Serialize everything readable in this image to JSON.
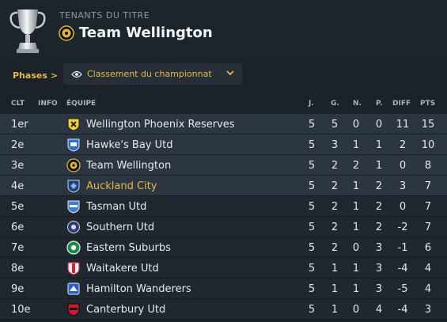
{
  "header": {
    "holder_label": "TENANTS DU TITRE",
    "holder_team": "Team Wellington"
  },
  "toolbar": {
    "phases_label": "Phases",
    "phases_chevron": ">",
    "view_label": "Classement du championnat"
  },
  "table": {
    "columns": [
      "CLT",
      "INFO",
      "ÉQUIPE",
      "J.",
      "G.",
      "N.",
      "P.",
      "DIFF",
      "PTS"
    ],
    "rows": [
      {
        "pos": "1er",
        "team": "Wellington Phoenix Reserves",
        "j": "5",
        "g": "5",
        "n": "0",
        "p": "0",
        "diff": "11",
        "pts": "15",
        "badge": "yellow-black-crest"
      },
      {
        "pos": "2e",
        "team": "Hawke's Bay Utd",
        "j": "5",
        "g": "3",
        "n": "1",
        "p": "1",
        "diff": "2",
        "pts": "10",
        "badge": "blue-white-crest"
      },
      {
        "pos": "3e",
        "team": "Team Wellington",
        "j": "5",
        "g": "2",
        "n": "2",
        "p": "1",
        "diff": "0",
        "pts": "8",
        "badge": "black-gold-ball-crest"
      },
      {
        "pos": "4e",
        "team": "Auckland City",
        "j": "5",
        "g": "2",
        "n": "1",
        "p": "2",
        "diff": "3",
        "pts": "7",
        "badge": "navy-shield-crest",
        "highlight": true
      },
      {
        "pos": "5e",
        "team": "Tasman Utd",
        "j": "5",
        "g": "2",
        "n": "1",
        "p": "2",
        "diff": "0",
        "pts": "7",
        "badge": "blue-stripe-crest"
      },
      {
        "pos": "6e",
        "team": "Southern Utd",
        "j": "5",
        "g": "2",
        "n": "1",
        "p": "2",
        "diff": "-2",
        "pts": "7",
        "badge": "navy-round-crest"
      },
      {
        "pos": "7e",
        "team": "Eastern Suburbs",
        "j": "5",
        "g": "2",
        "n": "0",
        "p": "3",
        "diff": "-1",
        "pts": "6",
        "badge": "green-white-crest"
      },
      {
        "pos": "8e",
        "team": "Waitakere Utd",
        "j": "5",
        "g": "1",
        "n": "1",
        "p": "3",
        "diff": "-4",
        "pts": "4",
        "badge": "red-white-crest"
      },
      {
        "pos": "9e",
        "team": "Hamilton Wanderers",
        "j": "5",
        "g": "1",
        "n": "1",
        "p": "3",
        "diff": "-5",
        "pts": "4",
        "badge": "blue-black-crest"
      },
      {
        "pos": "10e",
        "team": "Canterbury Utd",
        "j": "5",
        "g": "1",
        "n": "0",
        "p": "4",
        "diff": "-4",
        "pts": "3",
        "badge": "red-black-crest"
      }
    ]
  },
  "colors": {
    "accent": "#e8b84a",
    "background": "#1b2229",
    "row_top_band": "#2b3641",
    "row_base": "#1e262e"
  },
  "icons": [
    "trophy-icon",
    "team-crest-icon",
    "eye-icon",
    "chevron-down-icon"
  ]
}
